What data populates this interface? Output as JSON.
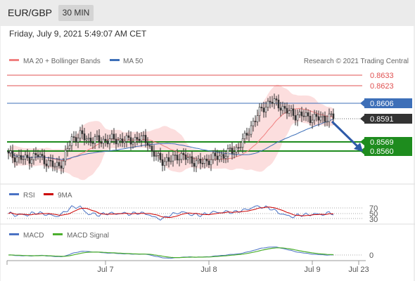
{
  "header": {
    "symbol": "EUR/GBP",
    "timeframe": "30 MIN"
  },
  "datetime": "Friday, July 9, 2021 5:49:07 AM CET",
  "copyright": "Research © 2021 Trading Central",
  "colors": {
    "ma20": "#f08080",
    "ma50": "#3d6fb8",
    "bollinger": "#fbd6d6",
    "level_red": "#e05050",
    "level_blue": "#3d6fb8",
    "level_green": "#1e8c1e",
    "arrow": "#2e5aa8",
    "rsi": "#4a72c4",
    "rsi_ma": "#cc0000",
    "macd": "#4a72c4",
    "macd_signal": "#4caf2e",
    "up_candle": "#ffffff",
    "down_candle": "#333333"
  },
  "main": {
    "legend": [
      {
        "name": "MA 20 + Bollinger Bands",
        "color": "#f08080"
      },
      {
        "name": "MA 50",
        "color": "#3d6fb8"
      }
    ],
    "levels": [
      {
        "label": "0.8633",
        "value": 0.8633,
        "style": "red"
      },
      {
        "label": "0.8623",
        "value": 0.8623,
        "style": "red"
      },
      {
        "label": "0.8606",
        "value": 0.8606,
        "style": "blue"
      },
      {
        "label": "0.8591",
        "value": 0.8591,
        "style": "current"
      },
      {
        "label": "0.8569",
        "value": 0.8569,
        "style": "green"
      },
      {
        "label": "0.8560",
        "value": 0.856,
        "style": "green"
      }
    ]
  },
  "rsi_panel": {
    "legend": [
      {
        "name": "RSI",
        "color": "#4a72c4"
      },
      {
        "name": "9MA",
        "color": "#cc0000"
      }
    ],
    "ticks": [
      "70",
      "50",
      "30"
    ]
  },
  "macd_panel": {
    "legend": [
      {
        "name": "MACD",
        "color": "#4a72c4"
      },
      {
        "name": "MACD Signal",
        "color": "#4caf2e"
      }
    ],
    "ticks": [
      "0"
    ]
  },
  "x_axis": {
    "labels": [
      "Jul 7",
      "Jul 8",
      "Jul 9",
      "Jul 23"
    ]
  },
  "chart_data": {
    "type": "candlestick",
    "instrument": "EUR/GBP",
    "interval": "30 MIN",
    "ylim": [
      0.852,
      0.865
    ],
    "close_anchors": [
      [
        0,
        0.8556
      ],
      [
        8,
        0.8552
      ],
      [
        14,
        0.8556
      ],
      [
        18,
        0.855
      ],
      [
        22,
        0.8545
      ],
      [
        26,
        0.855
      ],
      [
        28,
        0.8562
      ],
      [
        30,
        0.8572
      ],
      [
        34,
        0.8575
      ],
      [
        38,
        0.8571
      ],
      [
        44,
        0.857
      ],
      [
        50,
        0.8571
      ],
      [
        56,
        0.857
      ],
      [
        62,
        0.8572
      ],
      [
        66,
        0.857
      ],
      [
        68,
        0.8558
      ],
      [
        72,
        0.8552
      ],
      [
        76,
        0.855
      ],
      [
        80,
        0.8556
      ],
      [
        86,
        0.8552
      ],
      [
        90,
        0.8548
      ],
      [
        94,
        0.8551
      ],
      [
        100,
        0.8555
      ],
      [
        104,
        0.8558
      ],
      [
        108,
        0.8562
      ],
      [
        112,
        0.8572
      ],
      [
        116,
        0.8588
      ],
      [
        120,
        0.86
      ],
      [
        124,
        0.8608
      ],
      [
        128,
        0.8605
      ],
      [
        132,
        0.8598
      ],
      [
        136,
        0.8595
      ],
      [
        140,
        0.8594
      ],
      [
        144,
        0.8592
      ],
      [
        148,
        0.8591
      ],
      [
        152,
        0.8593
      ],
      [
        154,
        0.8591
      ]
    ],
    "current_price": 0.8591
  }
}
